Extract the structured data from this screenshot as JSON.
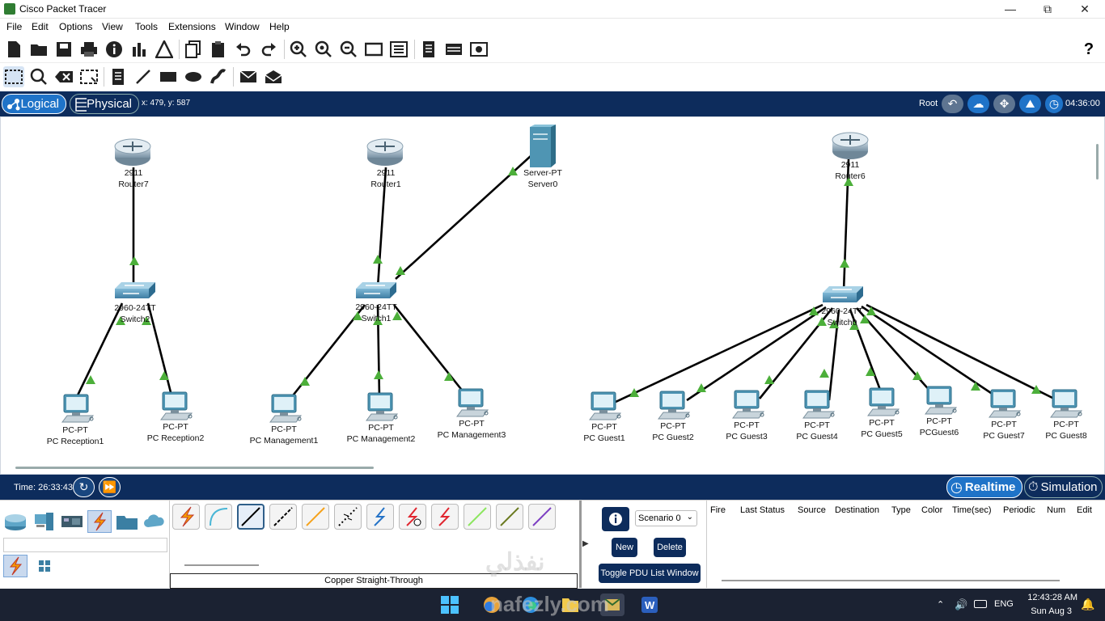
{
  "window": {
    "title": "Cisco Packet Tracer"
  },
  "menu": [
    "File",
    "Edit",
    "Options",
    "View",
    "Tools",
    "Extensions",
    "Window",
    "Help"
  ],
  "mode_bar": {
    "logical": "Logical",
    "physical": "Physical",
    "coords": "x: 479, y: 587",
    "root": "Root",
    "clock": "04:36:00"
  },
  "devices": {
    "router7": {
      "model": "2911",
      "name": "Router7"
    },
    "router1": {
      "model": "2911",
      "name": "Router1"
    },
    "router6": {
      "model": "2911",
      "name": "Router6"
    },
    "server0": {
      "model": "Server-PT",
      "name": "Server0"
    },
    "switch2": {
      "model": "2960-24TT",
      "name": "Switch2"
    },
    "switch1": {
      "model": "2960-24TT",
      "name": "Switch1"
    },
    "switch0": {
      "model": "2960-24TT",
      "name": "Switch0"
    },
    "pcs": [
      {
        "model": "PC-PT",
        "name": "PC Reception1"
      },
      {
        "model": "PC-PT",
        "name": "PC  Reception2"
      },
      {
        "model": "PC-PT",
        "name": "PC Management1"
      },
      {
        "model": "PC-PT",
        "name": "PC Management2"
      },
      {
        "model": "PC-PT",
        "name": "PC Management3"
      },
      {
        "model": "PC-PT",
        "name": "PC Guest1"
      },
      {
        "model": "PC-PT",
        "name": "PC Guest2"
      },
      {
        "model": "PC-PT",
        "name": "PC Guest3"
      },
      {
        "model": "PC-PT",
        "name": "PC Guest4"
      },
      {
        "model": "PC-PT",
        "name": "PC Guest5"
      },
      {
        "model": "PC-PT",
        "name": "PCGuest6"
      },
      {
        "model": "PC-PT",
        "name": "PC Guest7"
      },
      {
        "model": "PC-PT",
        "name": "PC Guest8"
      }
    ]
  },
  "time_bar": {
    "time": "Time: 26:33:43",
    "realtime": "Realtime",
    "simulation": "Simulation"
  },
  "bottom": {
    "cable_name": "Copper Straight-Through",
    "scenario": "Scenario 0",
    "new": "New",
    "delete": "Delete",
    "toggle": "Toggle PDU List Window",
    "pdu_columns": [
      "Fire",
      "Last Status",
      "Source",
      "Destination",
      "Type",
      "Color",
      "Time(sec)",
      "Periodic",
      "Num",
      "Edit"
    ]
  },
  "taskbar": {
    "lang": "ENG",
    "time": "12:43:28 AM",
    "date": "Sun Aug 3"
  },
  "watermark": {
    "line1": "نفذلي",
    "line2": "nafezly.com"
  },
  "colors": {
    "navy": "#0d2c5c",
    "link": "#000000",
    "link_up": "#4caf3a",
    "workspace_bg": "#ffffff"
  }
}
